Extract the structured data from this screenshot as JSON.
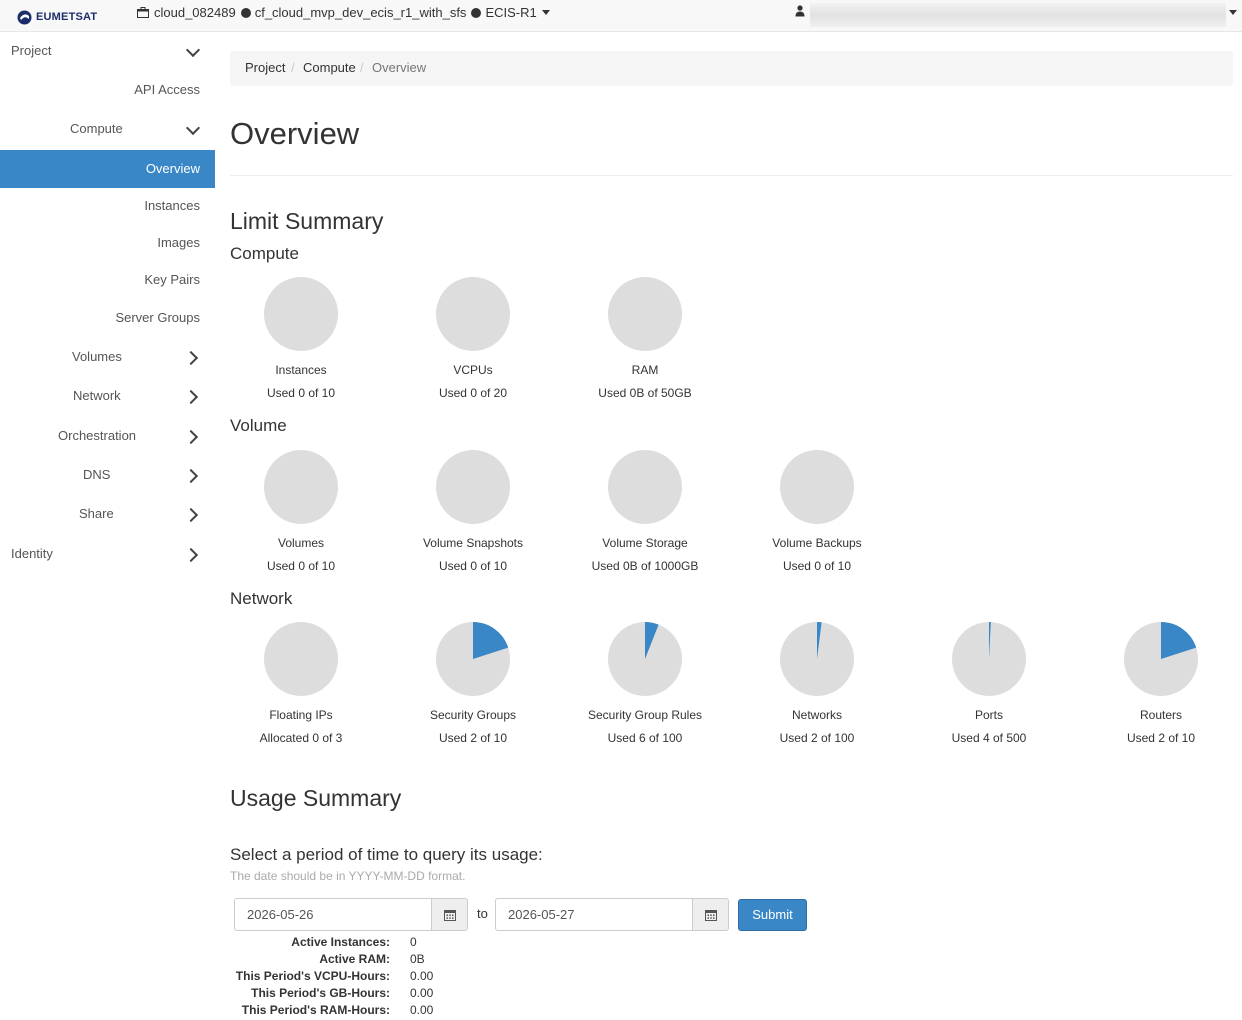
{
  "topbar": {
    "logo_text": "EUMETSAT",
    "domain": "cloud_082489",
    "project": "cf_cloud_mvp_dev_ecis_r1_with_sfs",
    "region": "ECIS-R1"
  },
  "sidebar": {
    "items": [
      {
        "label": "Project",
        "chevron": "down"
      },
      {
        "label": "API Access"
      },
      {
        "label": "Compute",
        "chevron": "down"
      },
      {
        "label": "Overview",
        "active": true
      },
      {
        "label": "Instances"
      },
      {
        "label": "Images"
      },
      {
        "label": "Key Pairs"
      },
      {
        "label": "Server Groups"
      },
      {
        "label": "Volumes",
        "chevron": "right"
      },
      {
        "label": "Network",
        "chevron": "right"
      },
      {
        "label": "Orchestration",
        "chevron": "right"
      },
      {
        "label": "DNS",
        "chevron": "right"
      },
      {
        "label": "Share",
        "chevron": "right"
      },
      {
        "label": "Identity",
        "chevron": "right"
      }
    ]
  },
  "breadcrumb": [
    "Project",
    "Compute",
    "Overview"
  ],
  "page_title": "Overview",
  "limit_summary": {
    "title": "Limit Summary",
    "sections": [
      {
        "title": "Compute",
        "pies": [
          {
            "name": "Instances",
            "usage": "Used 0 of 10",
            "fraction": 0
          },
          {
            "name": "VCPUs",
            "usage": "Used 0 of 20",
            "fraction": 0
          },
          {
            "name": "RAM",
            "usage": "Used 0B of 50GB",
            "fraction": 0
          }
        ]
      },
      {
        "title": "Volume",
        "pies": [
          {
            "name": "Volumes",
            "usage": "Used 0 of 10",
            "fraction": 0
          },
          {
            "name": "Volume Snapshots",
            "usage": "Used 0 of 10",
            "fraction": 0
          },
          {
            "name": "Volume Storage",
            "usage": "Used 0B of 1000GB",
            "fraction": 0
          },
          {
            "name": "Volume Backups",
            "usage": "Used 0 of 10",
            "fraction": 0
          }
        ]
      },
      {
        "title": "Network",
        "pies": [
          {
            "name": "Floating IPs",
            "usage": "Allocated 0 of 3",
            "fraction": 0
          },
          {
            "name": "Security Groups",
            "usage": "Used 2 of 10",
            "fraction": 0.2
          },
          {
            "name": "Security Group Rules",
            "usage": "Used 6 of 100",
            "fraction": 0.06
          },
          {
            "name": "Networks",
            "usage": "Used 2 of 100",
            "fraction": 0.02
          },
          {
            "name": "Ports",
            "usage": "Used 4 of 500",
            "fraction": 0.008
          },
          {
            "name": "Routers",
            "usage": "Used 2 of 10",
            "fraction": 0.2
          }
        ]
      }
    ]
  },
  "usage_summary": {
    "title": "Usage Summary",
    "period_heading": "Select a period of time to query its usage:",
    "help_text": "The date should be in YYYY-MM-DD format.",
    "start_date": "2026-05-26",
    "to_label": "to",
    "end_date": "2026-05-27",
    "submit_label": "Submit",
    "stats": [
      {
        "label": "Active Instances:",
        "value": "0"
      },
      {
        "label": "Active RAM:",
        "value": "0B"
      },
      {
        "label": "This Period's VCPU-Hours:",
        "value": "0.00"
      },
      {
        "label": "This Period's GB-Hours:",
        "value": "0.00"
      },
      {
        "label": "This Period's RAM-Hours:",
        "value": "0.00"
      }
    ]
  },
  "colors": {
    "accent": "#3a87c7",
    "pie_bg": "#dddddd"
  }
}
